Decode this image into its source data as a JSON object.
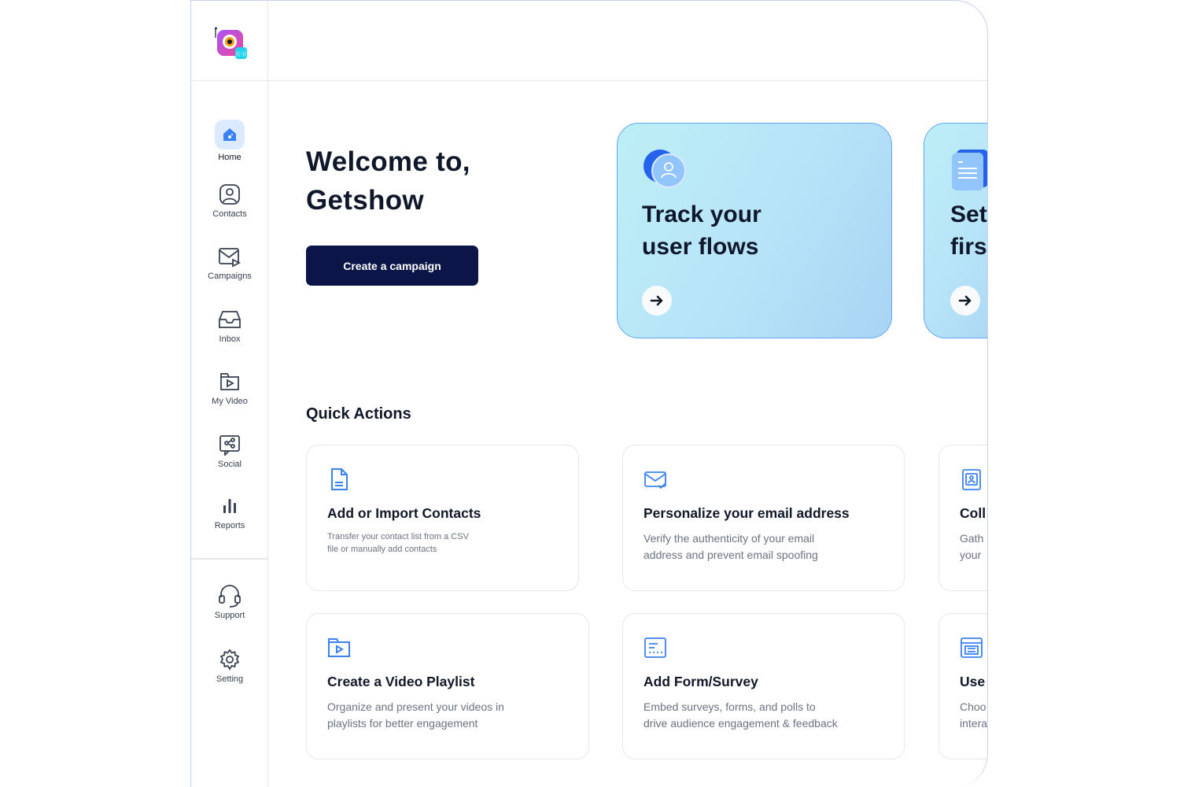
{
  "nav": {
    "items": [
      {
        "label": "Home",
        "icon": "home-icon",
        "active": true
      },
      {
        "label": "Contacts",
        "icon": "contact-icon"
      },
      {
        "label": "Campaigns",
        "icon": "mail-send-icon"
      },
      {
        "label": "Inbox",
        "icon": "inbox-icon"
      },
      {
        "label": "My Video",
        "icon": "video-icon"
      },
      {
        "label": "Social",
        "icon": "share-icon"
      },
      {
        "label": "Reports",
        "icon": "bar-chart-icon"
      }
    ],
    "bottom": [
      {
        "label": "Support",
        "icon": "headset-icon"
      },
      {
        "label": "Setting",
        "icon": "gear-icon"
      }
    ]
  },
  "welcome": {
    "line1": "Welcome to,",
    "line2": "Getshow",
    "cta_label": "Create a campaign"
  },
  "promos": [
    {
      "line1": "Track your",
      "line2": "user flows",
      "icon": "user-icon"
    },
    {
      "line1": "Set",
      "line2": "firs",
      "icon": "document-icon"
    }
  ],
  "quick_actions": {
    "title": "Quick Actions",
    "cards": [
      {
        "title": "Add or Import Contacts",
        "desc1": "Transfer your contact list from a CSV",
        "desc2": "file or manually add contacts",
        "icon": "file-icon"
      },
      {
        "title": "Personalize your email address",
        "desc1": "Verify the authenticity of your email",
        "desc2": "address and prevent email spoofing",
        "icon": "mail-check-icon"
      },
      {
        "title": "Coll",
        "desc1": "Gath",
        "desc2": "your",
        "icon": "contact-card-icon"
      },
      {
        "title": "Create a Video Playlist",
        "desc1": "Organize and present your videos in",
        "desc2": "playlists for better engagement",
        "icon": "video-folder-icon"
      },
      {
        "title": "Add Form/Survey",
        "desc1": "Embed surveys, forms, and polls to",
        "desc2": "drive audience engagement & feedback",
        "icon": "form-icon"
      },
      {
        "title": "Use",
        "desc1": "Choo",
        "desc2": "intera",
        "icon": "template-icon"
      }
    ]
  },
  "colors": {
    "accent": "#0b1547",
    "brand_blue": "#3b82f6",
    "promo_border": "#60a5fa"
  }
}
